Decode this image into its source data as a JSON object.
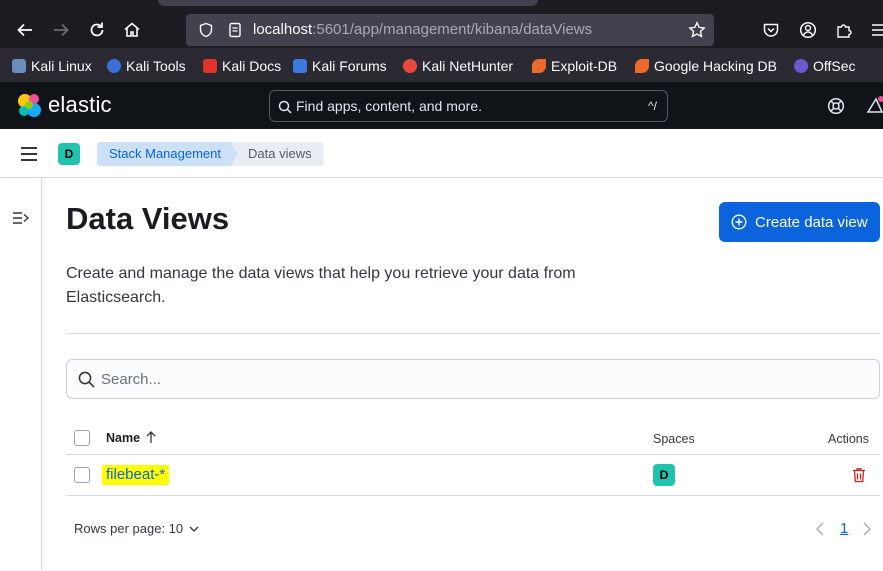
{
  "browser": {
    "url_host": "localhost",
    "url_rest": ":5601/app/management/kibana/dataViews",
    "bookmarks": [
      {
        "label": "Kali Linux",
        "color": "#367bf0"
      },
      {
        "label": "Kali Tools",
        "color": "#3b6fd8"
      },
      {
        "label": "Kali Docs",
        "color": "#e0342b"
      },
      {
        "label": "Kali Forums",
        "color": "#3d7ae0"
      },
      {
        "label": "Kali NetHunter",
        "color": "#e64a3c"
      },
      {
        "label": "Exploit-DB",
        "color": "#ec6a2b"
      },
      {
        "label": "Google Hacking DB",
        "color": "#ec6a2b"
      },
      {
        "label": "OffSec",
        "color": "#6a5acd"
      }
    ]
  },
  "kibana": {
    "brand": "elastic",
    "search_placeholder": "Find apps, content, and more.",
    "search_shortcut": "^/",
    "space_initial": "D",
    "breadcrumbs": [
      "Stack Management",
      "Data views"
    ]
  },
  "page": {
    "title": "Data Views",
    "create_button": "Create data view",
    "description": "Create and manage the data views that help you retrieve your data from Elasticsearch.",
    "search_placeholder": "Search...",
    "columns": {
      "name": "Name",
      "spaces": "Spaces",
      "actions": "Actions"
    },
    "rows": [
      {
        "name": "filebeat-*",
        "space": "D"
      }
    ],
    "rows_per_page": "Rows per page: 10",
    "current_page": "1"
  },
  "colors": {
    "primary": "#0b64dd",
    "space_badge": "#22c3ae",
    "header_bg": "#101419",
    "highlight": "#ffff00",
    "danger": "#bd271e"
  }
}
